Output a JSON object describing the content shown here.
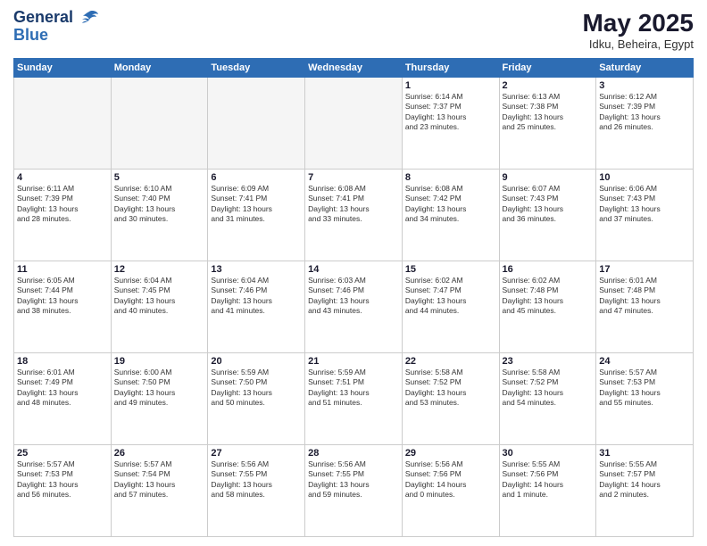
{
  "header": {
    "logo_line1": "General",
    "logo_line2": "Blue",
    "month_title": "May 2025",
    "location": "Idku, Beheira, Egypt"
  },
  "weekdays": [
    "Sunday",
    "Monday",
    "Tuesday",
    "Wednesday",
    "Thursday",
    "Friday",
    "Saturday"
  ],
  "weeks": [
    [
      {
        "day": "",
        "info": ""
      },
      {
        "day": "",
        "info": ""
      },
      {
        "day": "",
        "info": ""
      },
      {
        "day": "",
        "info": ""
      },
      {
        "day": "1",
        "info": "Sunrise: 6:14 AM\nSunset: 7:37 PM\nDaylight: 13 hours\nand 23 minutes."
      },
      {
        "day": "2",
        "info": "Sunrise: 6:13 AM\nSunset: 7:38 PM\nDaylight: 13 hours\nand 25 minutes."
      },
      {
        "day": "3",
        "info": "Sunrise: 6:12 AM\nSunset: 7:39 PM\nDaylight: 13 hours\nand 26 minutes."
      }
    ],
    [
      {
        "day": "4",
        "info": "Sunrise: 6:11 AM\nSunset: 7:39 PM\nDaylight: 13 hours\nand 28 minutes."
      },
      {
        "day": "5",
        "info": "Sunrise: 6:10 AM\nSunset: 7:40 PM\nDaylight: 13 hours\nand 30 minutes."
      },
      {
        "day": "6",
        "info": "Sunrise: 6:09 AM\nSunset: 7:41 PM\nDaylight: 13 hours\nand 31 minutes."
      },
      {
        "day": "7",
        "info": "Sunrise: 6:08 AM\nSunset: 7:41 PM\nDaylight: 13 hours\nand 33 minutes."
      },
      {
        "day": "8",
        "info": "Sunrise: 6:08 AM\nSunset: 7:42 PM\nDaylight: 13 hours\nand 34 minutes."
      },
      {
        "day": "9",
        "info": "Sunrise: 6:07 AM\nSunset: 7:43 PM\nDaylight: 13 hours\nand 36 minutes."
      },
      {
        "day": "10",
        "info": "Sunrise: 6:06 AM\nSunset: 7:43 PM\nDaylight: 13 hours\nand 37 minutes."
      }
    ],
    [
      {
        "day": "11",
        "info": "Sunrise: 6:05 AM\nSunset: 7:44 PM\nDaylight: 13 hours\nand 38 minutes."
      },
      {
        "day": "12",
        "info": "Sunrise: 6:04 AM\nSunset: 7:45 PM\nDaylight: 13 hours\nand 40 minutes."
      },
      {
        "day": "13",
        "info": "Sunrise: 6:04 AM\nSunset: 7:46 PM\nDaylight: 13 hours\nand 41 minutes."
      },
      {
        "day": "14",
        "info": "Sunrise: 6:03 AM\nSunset: 7:46 PM\nDaylight: 13 hours\nand 43 minutes."
      },
      {
        "day": "15",
        "info": "Sunrise: 6:02 AM\nSunset: 7:47 PM\nDaylight: 13 hours\nand 44 minutes."
      },
      {
        "day": "16",
        "info": "Sunrise: 6:02 AM\nSunset: 7:48 PM\nDaylight: 13 hours\nand 45 minutes."
      },
      {
        "day": "17",
        "info": "Sunrise: 6:01 AM\nSunset: 7:48 PM\nDaylight: 13 hours\nand 47 minutes."
      }
    ],
    [
      {
        "day": "18",
        "info": "Sunrise: 6:01 AM\nSunset: 7:49 PM\nDaylight: 13 hours\nand 48 minutes."
      },
      {
        "day": "19",
        "info": "Sunrise: 6:00 AM\nSunset: 7:50 PM\nDaylight: 13 hours\nand 49 minutes."
      },
      {
        "day": "20",
        "info": "Sunrise: 5:59 AM\nSunset: 7:50 PM\nDaylight: 13 hours\nand 50 minutes."
      },
      {
        "day": "21",
        "info": "Sunrise: 5:59 AM\nSunset: 7:51 PM\nDaylight: 13 hours\nand 51 minutes."
      },
      {
        "day": "22",
        "info": "Sunrise: 5:58 AM\nSunset: 7:52 PM\nDaylight: 13 hours\nand 53 minutes."
      },
      {
        "day": "23",
        "info": "Sunrise: 5:58 AM\nSunset: 7:52 PM\nDaylight: 13 hours\nand 54 minutes."
      },
      {
        "day": "24",
        "info": "Sunrise: 5:57 AM\nSunset: 7:53 PM\nDaylight: 13 hours\nand 55 minutes."
      }
    ],
    [
      {
        "day": "25",
        "info": "Sunrise: 5:57 AM\nSunset: 7:53 PM\nDaylight: 13 hours\nand 56 minutes."
      },
      {
        "day": "26",
        "info": "Sunrise: 5:57 AM\nSunset: 7:54 PM\nDaylight: 13 hours\nand 57 minutes."
      },
      {
        "day": "27",
        "info": "Sunrise: 5:56 AM\nSunset: 7:55 PM\nDaylight: 13 hours\nand 58 minutes."
      },
      {
        "day": "28",
        "info": "Sunrise: 5:56 AM\nSunset: 7:55 PM\nDaylight: 13 hours\nand 59 minutes."
      },
      {
        "day": "29",
        "info": "Sunrise: 5:56 AM\nSunset: 7:56 PM\nDaylight: 14 hours\nand 0 minutes."
      },
      {
        "day": "30",
        "info": "Sunrise: 5:55 AM\nSunset: 7:56 PM\nDaylight: 14 hours\nand 1 minute."
      },
      {
        "day": "31",
        "info": "Sunrise: 5:55 AM\nSunset: 7:57 PM\nDaylight: 14 hours\nand 2 minutes."
      }
    ]
  ]
}
